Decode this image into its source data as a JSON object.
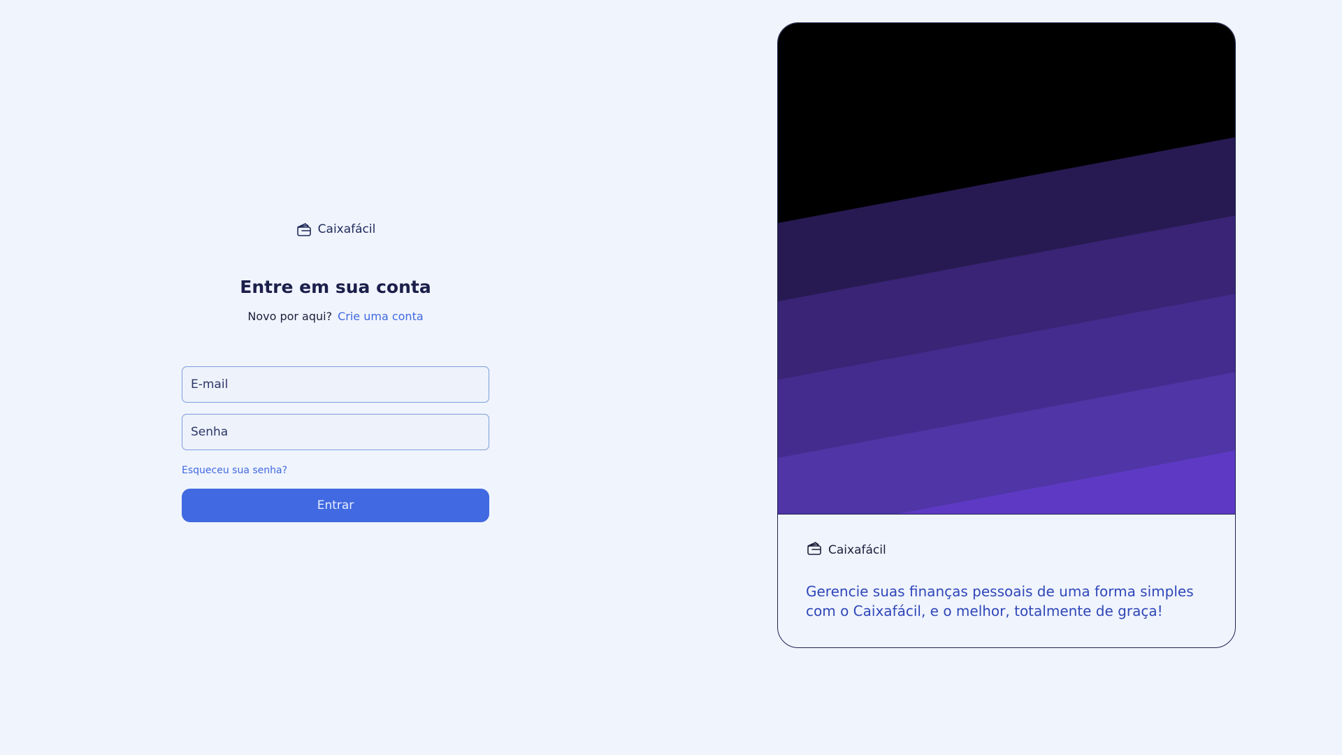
{
  "brand": {
    "name": "Caixafácil",
    "icon": "wallet-icon"
  },
  "login": {
    "title": "Entre em sua conta",
    "signup_prompt": "Novo por aqui?",
    "signup_link": "Crie uma conta",
    "email_placeholder": "E-mail",
    "password_placeholder": "Senha",
    "forgot_password": "Esqueceu sua senha?",
    "submit_label": "Entrar"
  },
  "promo": {
    "brand_name": "Caixafácil",
    "message": "Gerencie suas finanças pessoais de uma forma simples com o Caixafácil, e o melhor, totalmente de graça!"
  },
  "colors": {
    "background": "#f0f4fd",
    "accent": "#4169e1",
    "promo_text": "#2f47b8",
    "art_bands": [
      "#000000",
      "#271a52",
      "#392475",
      "#442c8e",
      "#4f35a6",
      "#5e3ac4"
    ]
  }
}
